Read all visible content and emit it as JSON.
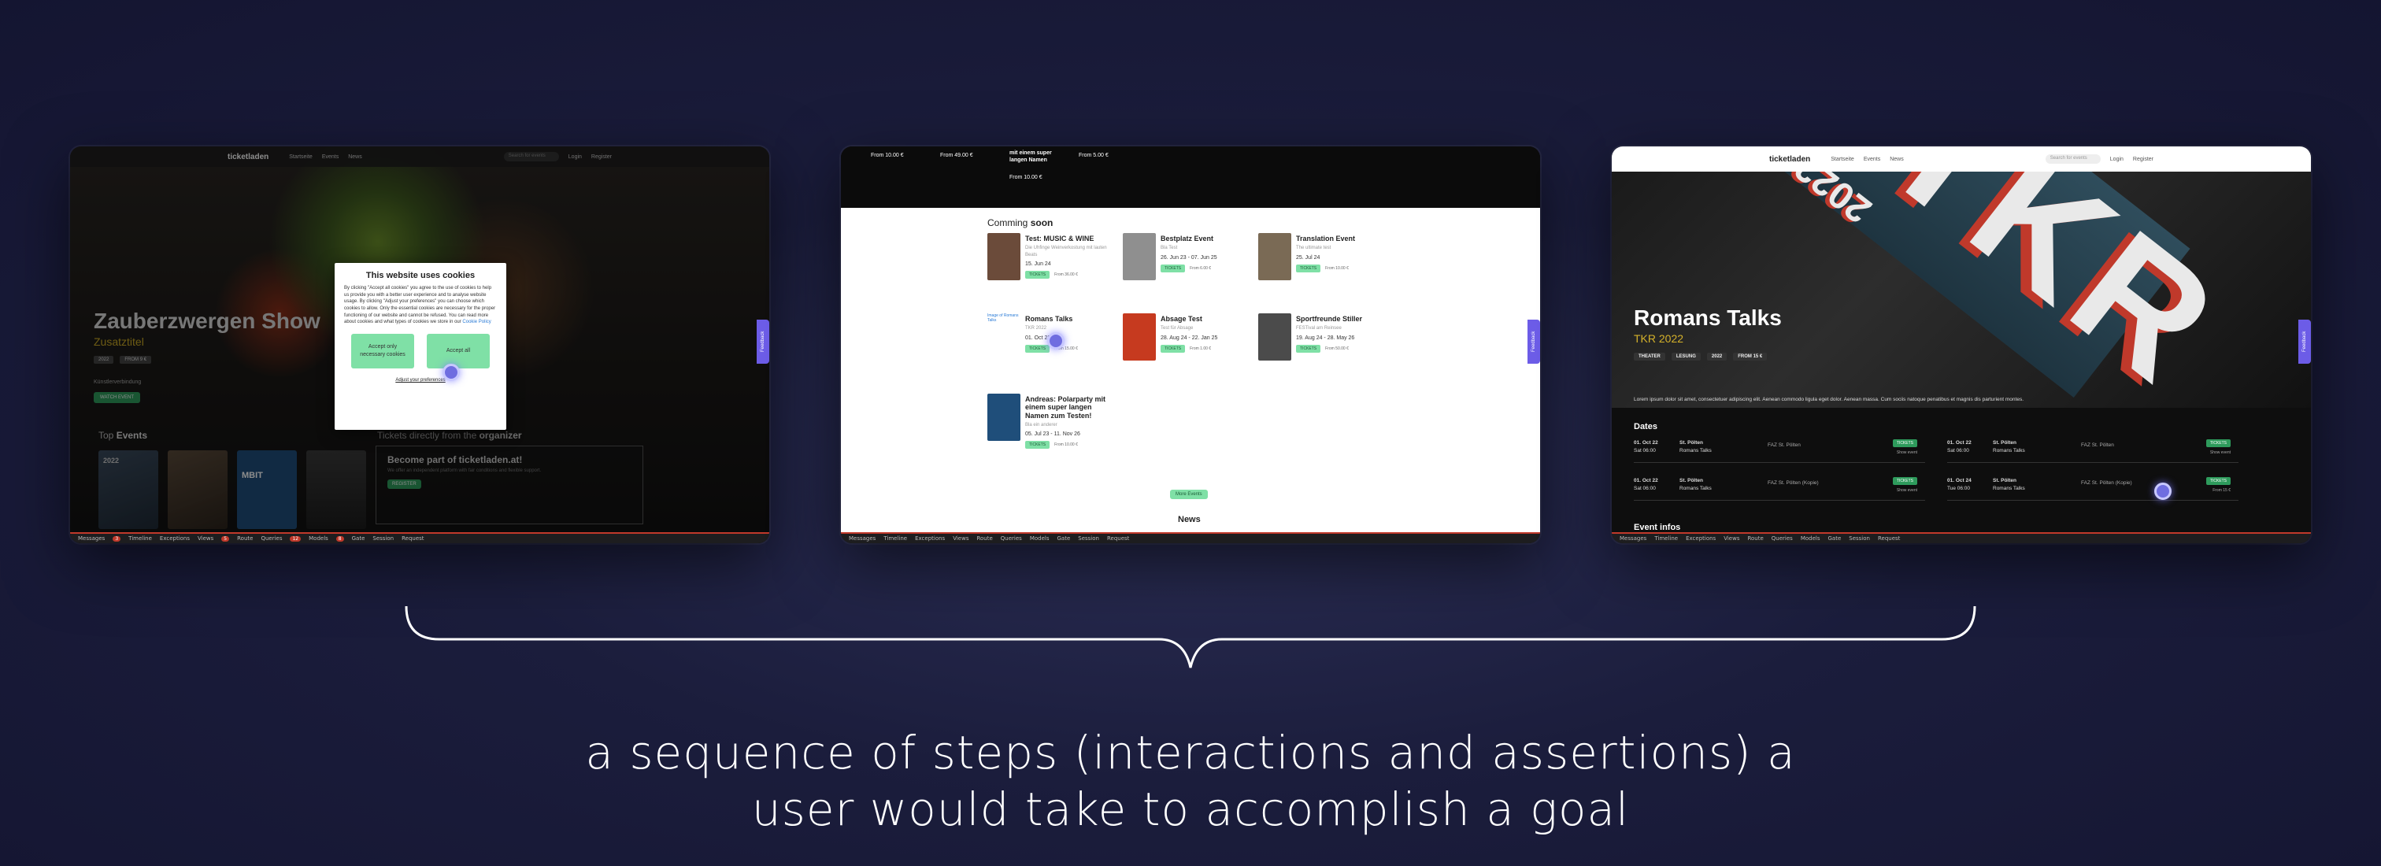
{
  "devbar": {
    "items": [
      "Messages",
      "Timeline",
      "Exceptions",
      "Views",
      "Route",
      "Queries",
      "Models",
      "Gate",
      "Session",
      "Request"
    ],
    "counts": {
      "messages": "3",
      "views": "5",
      "queries": "12",
      "models": "8"
    }
  },
  "feedback_label": "Feedback",
  "step1": {
    "logo": "ticketladen",
    "nav": [
      "Startseite",
      "Events",
      "News"
    ],
    "search_placeholder": "Search for events",
    "login": "Login",
    "register": "Register",
    "title": "Zauberzwergen Show",
    "subtitle": "Zusatztitel",
    "tags": [
      "2022",
      "FROM 9 €"
    ],
    "organizer_label": "Künstlerverbindung",
    "watch_button": "WATCH EVENT",
    "top_events_prefix": "Top ",
    "top_events_bold": "Events",
    "thumb_labels": [
      "2022",
      "MBIT"
    ],
    "organizer_heading_prefix": "Tickets directly from the ",
    "organizer_heading_bold": "organizer",
    "become_title": "Become part of ticketladen.at!",
    "become_text": "We offer an independent platform with fair conditions and flexible support.",
    "become_button": "REGISTER",
    "cookie": {
      "title": "This website uses cookies",
      "text": "By clicking \"Accept all cookies\" you agree to the use of cookies to help us provide you with a better user experience and to analyse website usage. By clicking \"Adjust your preferences\" you can choose which cookies to allow. Only the essential cookies are necessary for the proper functioning of our website and cannot be refused. You can read more about cookies and what types of cookies we store in our ",
      "link": "Cookie Policy",
      "accept_necessary": "Accept only necessary cookies",
      "accept_all": "Accept all",
      "adjust": "Adjust your preferences"
    }
  },
  "step2": {
    "top_prices": [
      "From 10.00 €",
      "From 49.00 €",
      "From 10.00 €",
      "From 5.00 €"
    ],
    "top_title": "mit einem super langen Namen",
    "heading_prefix": "Comming ",
    "heading_bold": "soon",
    "cards": [
      {
        "title": "Test: MUSIC & WINE",
        "sub": "Die Uhfinge Weinverkostung mit lauten Beats",
        "date": "15. Jun 24",
        "ticket": "TICKETS",
        "price": "From 36.00 €",
        "color": "#6b4b3a"
      },
      {
        "title": "Bestplatz Event",
        "sub": "Bla Test",
        "date": "26. Jun 23 - 07. Jun 25",
        "ticket": "TICKETS",
        "price": "From 6.00 €",
        "color": "#8f8f8f"
      },
      {
        "title": "Translation Event",
        "sub": "The ultimate test",
        "date": "25. Jul 24",
        "ticket": "TICKETS",
        "price": "From 10.00 €",
        "color": "#7a6a55"
      },
      {
        "title": "Romans Talks",
        "sub": "TKR 2022",
        "date": "01. Oct 22",
        "ticket": "TICKETS",
        "price": "From 15.00 €",
        "color": "#cfe2f7"
      },
      {
        "title": "Absage Test",
        "sub": "Test für Absage",
        "date": "28. Aug 24 - 22. Jan 25",
        "ticket": "TICKETS",
        "price": "From 1.00 €",
        "color": "#c63a1f"
      },
      {
        "title": "Sportfreunde Stiller",
        "sub": "FESTival am Reinsee",
        "date": "19. Aug 24 - 28. May 26",
        "ticket": "TICKETS",
        "price": "From 50.00 €",
        "color": "#4b4b4b"
      },
      {
        "title": "Andreas: Polarparty mit einem super langen Namen zum Testen!",
        "sub": "Bla ein anderer",
        "date": "05. Jul 23 - 11. Nov 26",
        "ticket": "TICKETS",
        "price": "From 10.00 €",
        "color": "#1f4e7a"
      }
    ],
    "broken_image_text": "Image of Romans Talks",
    "more_button": "More Events",
    "news_heading": "News"
  },
  "step3": {
    "logo": "ticketladen",
    "nav": [
      "Startseite",
      "Events",
      "News"
    ],
    "search_placeholder": "Search for events",
    "login": "Login",
    "register": "Register",
    "hero_text": "TKR",
    "hero_small": "2022",
    "title": "Romans Talks",
    "subtitle": "TKR 2022",
    "tags": [
      "THEATER",
      "LESUNG",
      "2022",
      "FROM 15 €"
    ],
    "lorem": "Lorem ipsum dolor sit amet, consectetuer adipiscing elit. Aenean commodo ligula eget dolor. Aenean massa. Cum sociis natoque penatibus et magnis dis parturient montes.",
    "dates_heading": "Dates",
    "dates": [
      {
        "date": "01. Oct 22",
        "time": "Sat 06:00",
        "city": "St. Pölten",
        "event": "Romans Talks",
        "venue": "FAZ St. Pölten",
        "ticket": "TICKETS",
        "note": "Show event"
      },
      {
        "date": "01. Oct 22",
        "time": "Sat 06:00",
        "city": "St. Pölten",
        "event": "Romans Talks",
        "venue": "FAZ St. Pölten (Kopie)",
        "ticket": "TICKETS",
        "note": "Show event"
      },
      {
        "date": "01. Oct 22",
        "time": "Sat 06:00",
        "city": "St. Pölten",
        "event": "Romans Talks",
        "venue": "FAZ St. Pölten",
        "ticket": "TICKETS",
        "note": "Show event"
      },
      {
        "date": "01. Oct 24",
        "time": "Tue 06:00",
        "city": "St. Pölten",
        "event": "Romans Talks",
        "venue": "FAZ St. Pölten (Kopie)",
        "ticket": "TICKETS",
        "note": "From 15 €"
      }
    ],
    "infos_heading": "Event infos"
  },
  "caption": {
    "line1": "a sequence of steps (interactions and assertions) a",
    "line2": "user would take to accomplish a goal"
  },
  "colors": {
    "accent_green": "#7fe0a6",
    "ticket_green": "#2e9b5c",
    "gold": "#d4b12a",
    "cursor": "#6f6de0",
    "background": "#1b1d3c"
  }
}
